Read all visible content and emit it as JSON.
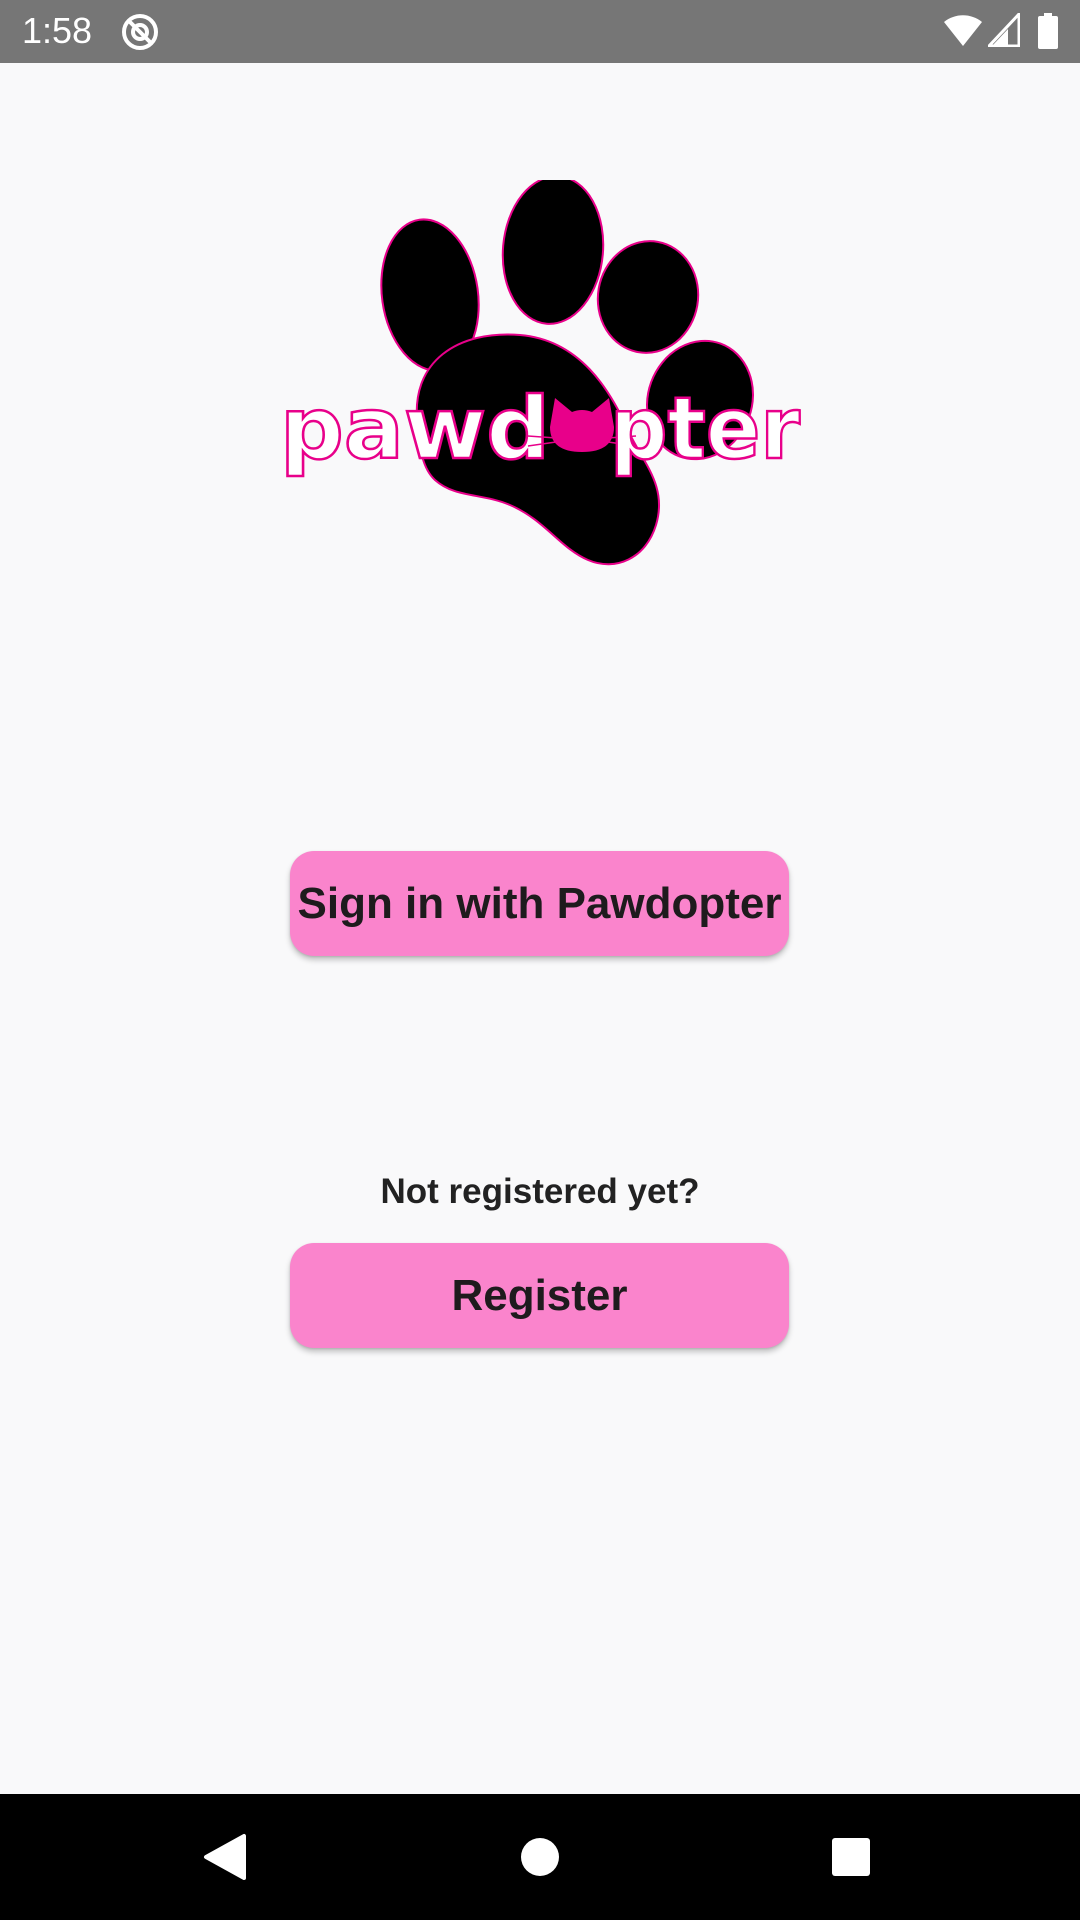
{
  "status_bar": {
    "time": "1:58",
    "icons": [
      "do-not-disturb-icon",
      "wifi-icon",
      "cell-signal-icon",
      "battery-icon"
    ]
  },
  "logo": {
    "text_before": "pawd",
    "text_after": "pter",
    "colors": {
      "paw": "#000000",
      "accent": "#e8008a",
      "text_fill": "#ffffff"
    }
  },
  "buttons": {
    "sign_in_label": "Sign in with Pawdopter",
    "register_label": "Register"
  },
  "prompt": {
    "not_registered": "Not registered yet?"
  },
  "nav_bar": {
    "icons": [
      "back-icon",
      "home-icon",
      "recents-icon"
    ]
  },
  "colors": {
    "button_background": "#fa84cc",
    "button_text": "#1e1b1d",
    "page_background": "#f9f9fa",
    "status_bar": "#767676",
    "nav_bar": "#000000"
  }
}
